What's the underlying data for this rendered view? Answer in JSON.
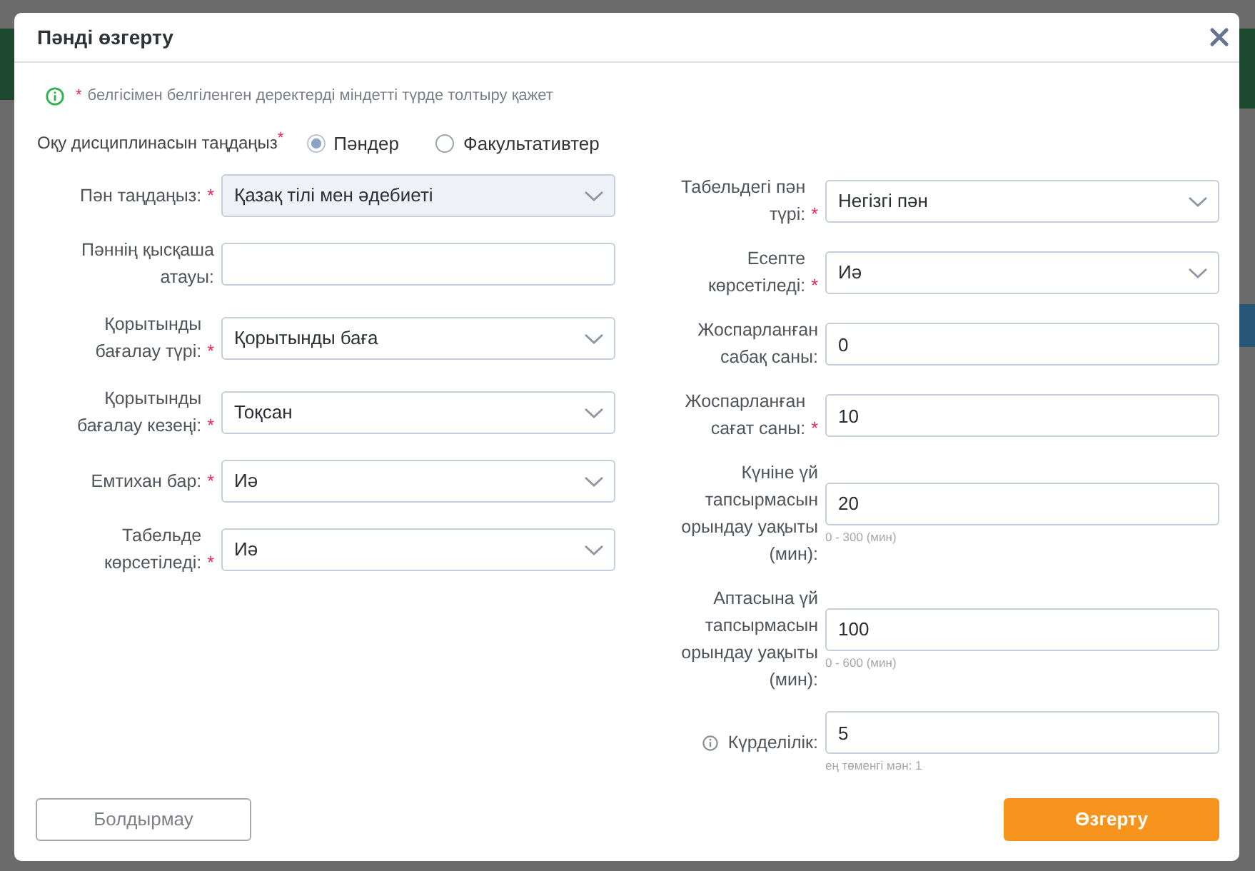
{
  "dialog": {
    "title": "Пәнді өзгерту"
  },
  "notice": {
    "mark": "*",
    "text": "белгісімен белгіленген деректерді міндетті түрде толтыру қажет"
  },
  "discipline": {
    "label": "Оқу дисциплинасын таңдаңыз",
    "mark": "*",
    "options": [
      {
        "label": "Пәндер",
        "selected": true
      },
      {
        "label": "Факультативтер",
        "selected": false
      }
    ]
  },
  "left_fields": [
    {
      "kind": "select",
      "label": "Пән таңдаңыз:",
      "mark": "*",
      "value": "Қазақ тілі мен әдебиеті",
      "disabled": true,
      "info": false
    },
    {
      "kind": "input",
      "label": "Пәннің қысқаша атауы:",
      "disabled": false,
      "info": false
    },
    {
      "kind": "select",
      "label": "Қорытынды бағалау түрі:",
      "mark": "*",
      "value": "Қорытынды баға",
      "disabled": false,
      "info": false
    },
    {
      "kind": "select",
      "label": "Қорытынды бағалау кезеңі:",
      "mark": "*",
      "value": "Тоқсан",
      "disabled": false,
      "info": false
    },
    {
      "kind": "select",
      "label": "Емтихан бар:",
      "mark": "*",
      "value": "Иә",
      "disabled": false,
      "info": false
    },
    {
      "kind": "select",
      "label": "Табельде көрсетіледі:",
      "mark": "*",
      "value": "Иә",
      "disabled": false,
      "info": false
    }
  ],
  "right_fields": [
    {
      "kind": "select",
      "label": "Табельдегі пән түрі:",
      "mark": "*",
      "value": "Негізгі пән",
      "disabled": false,
      "info": false
    },
    {
      "kind": "select",
      "label": "Есепте көрсетіледі:",
      "mark": "*",
      "value": "Иә",
      "disabled": false,
      "info": false
    },
    {
      "kind": "input",
      "label": "Жоспарланған сабақ саны:",
      "value": "0",
      "disabled": false,
      "info": false
    },
    {
      "kind": "input",
      "label": "Жоспарланған сағат саны:",
      "mark": "*",
      "value": "10",
      "disabled": false,
      "info": false
    },
    {
      "kind": "input",
      "label": "Күніне үй тапсырмасын орындау уақыты (мин):",
      "value": "20",
      "help": "0 - 300 (мин)",
      "disabled": false,
      "info": false
    },
    {
      "kind": "input",
      "label": "Аптасына үй тапсырмасын орындау уақыты (мин):",
      "value": "100",
      "help": "0 - 600 (мин)",
      "disabled": false,
      "info": false
    },
    {
      "kind": "input",
      "label": "Күрделілік:",
      "value": "5",
      "help": "ең төменгі мән: 1",
      "disabled": false,
      "info": true
    }
  ],
  "buttons": [
    {
      "kind": "cancel",
      "label": "Болдырмау"
    },
    {
      "kind": "submit",
      "label": "Өзгерту"
    }
  ]
}
